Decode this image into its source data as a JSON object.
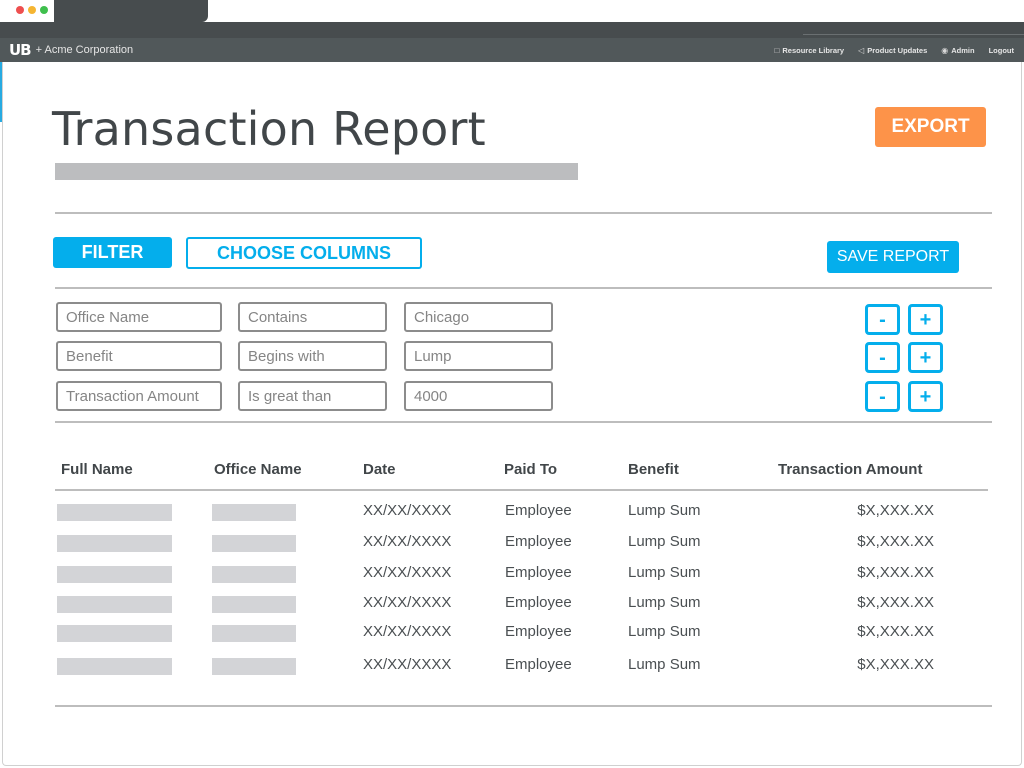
{
  "browser": {
    "window_controls": [
      "close",
      "minimize",
      "maximize"
    ]
  },
  "appbar": {
    "logo_mark": "UB",
    "logo_text": "+ Acme Corporation",
    "nav": [
      {
        "label": "Resource Library",
        "icon": "book-icon",
        "glyph": "□"
      },
      {
        "label": "Product Updates",
        "icon": "megaphone-icon",
        "glyph": "◁"
      },
      {
        "label": "Admin",
        "icon": "gear-icon",
        "glyph": "◉"
      },
      {
        "label": "Logout",
        "icon": "",
        "glyph": ""
      }
    ]
  },
  "page": {
    "title": "Transaction Report",
    "export_label": "EXPORT",
    "filter_label": "FILTER",
    "choose_columns_label": "CHOOSE COLUMNS",
    "save_report_label": "SAVE REPORT"
  },
  "filters": [
    {
      "field": "Office Name",
      "operator": "Contains",
      "value": "Chicago",
      "minus": "-",
      "plus": "+"
    },
    {
      "field": "Benefit",
      "operator": "Begins with",
      "value": "Lump",
      "minus": "-",
      "plus": "+"
    },
    {
      "field": "Transaction Amount",
      "operator": "Is great than",
      "value": "4000",
      "minus": "-",
      "plus": "+"
    }
  ],
  "table": {
    "columns": [
      "Full Name",
      "Office Name",
      "Date",
      "Paid To",
      "Benefit",
      "Transaction Amount"
    ],
    "rows": [
      {
        "date": "XX/XX/XXXX",
        "paid_to": "Employee",
        "benefit": "Lump Sum",
        "amount": "$X,XXX.XX"
      },
      {
        "date": "XX/XX/XXXX",
        "paid_to": "Employee",
        "benefit": "Lump Sum",
        "amount": "$X,XXX.XX"
      },
      {
        "date": "XX/XX/XXXX",
        "paid_to": "Employee",
        "benefit": "Lump Sum",
        "amount": "$X,XXX.XX"
      },
      {
        "date": "XX/XX/XXXX",
        "paid_to": "Employee",
        "benefit": "Lump Sum",
        "amount": "$X,XXX.XX"
      },
      {
        "date": "XX/XX/XXXX",
        "paid_to": "Employee",
        "benefit": "Lump Sum",
        "amount": "$X,XXX.XX"
      },
      {
        "date": "XX/XX/XXXX",
        "paid_to": "Employee",
        "benefit": "Lump Sum",
        "amount": "$X,XXX.XX"
      }
    ]
  },
  "colors": {
    "primary": "#04aeec",
    "export": "#fd9349",
    "appbar": "#51585a",
    "chrome": "#474c4e",
    "placeholder": "#d3d4d7"
  }
}
